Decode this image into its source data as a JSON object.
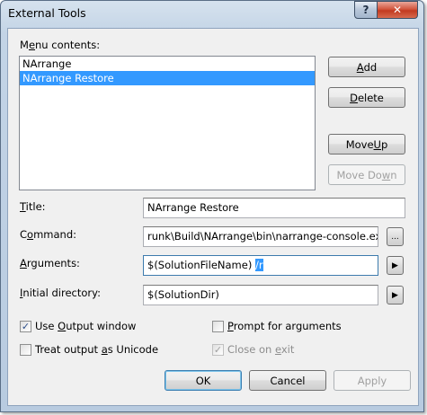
{
  "window": {
    "title": "External Tools",
    "help_glyph": "?",
    "close_glyph": "✕"
  },
  "menu_contents": {
    "label_pre": "M",
    "label_u": "e",
    "label_post": "nu contents:",
    "items": [
      {
        "label": "NArrange",
        "selected": false
      },
      {
        "label": "NArrange Restore",
        "selected": true
      }
    ]
  },
  "buttons": {
    "add": {
      "u": "A",
      "rest": "dd"
    },
    "delete": {
      "u": "D",
      "rest": "elete"
    },
    "move_up": {
      "pre": "Move ",
      "u": "U",
      "rest": "p"
    },
    "move_down": {
      "pre": "Move Do",
      "u": "w",
      "rest": "n"
    },
    "ok": "OK",
    "cancel": "Cancel",
    "apply": "Apply",
    "browse": "...",
    "arrow": "▶"
  },
  "fields": {
    "title": {
      "label_u": "T",
      "label_rest": "itle:",
      "value": "NArrange Restore"
    },
    "command": {
      "label_pre": "C",
      "label_u": "o",
      "label_rest": "mmand:",
      "value": "runk\\Build\\NArrange\\bin\\narrange-console.exe"
    },
    "arguments": {
      "label_u": "A",
      "label_rest": "rguments:",
      "value": "$(SolutionFileName) ",
      "selected": "/r"
    },
    "initial_directory": {
      "label_u": "I",
      "label_rest": "nitial directory:",
      "value": "$(SolutionDir)"
    }
  },
  "options": {
    "use_output": {
      "pre": "Use ",
      "u": "O",
      "rest": "utput window",
      "checked": true
    },
    "prompt_args": {
      "u": "P",
      "rest": "rompt for arguments",
      "checked": false
    },
    "unicode": {
      "pre": "Treat output ",
      "u": "a",
      "rest": "s Unicode",
      "checked": false
    },
    "close_exit": {
      "pre": "Close on ",
      "u": "e",
      "rest": "xit",
      "checked": true,
      "disabled": true
    }
  },
  "glyphs": {
    "check": "✓"
  }
}
